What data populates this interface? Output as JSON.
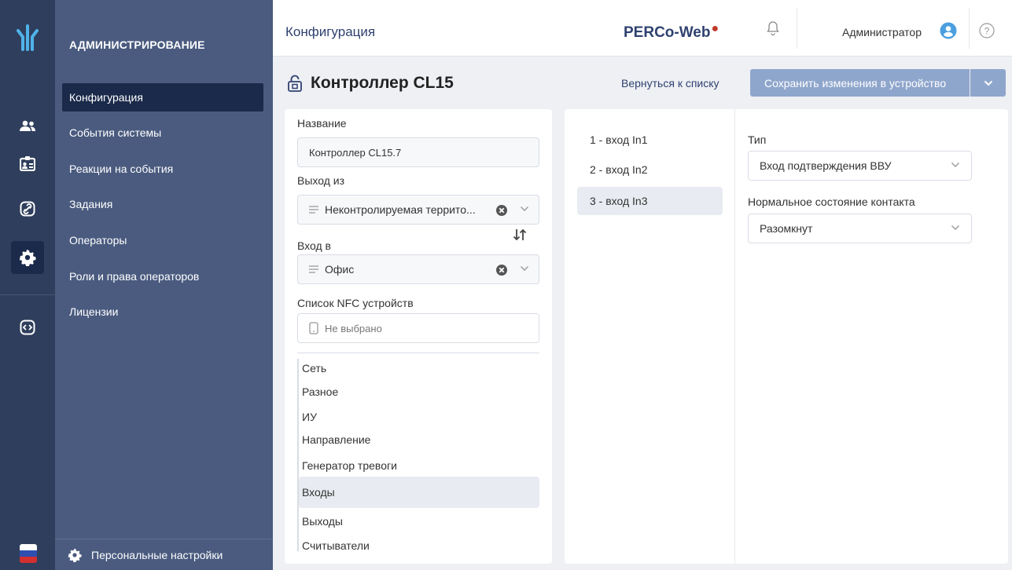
{
  "colors": {
    "rail": "#2f3e5c",
    "nav": "#4a5b7f",
    "nav_active": "#1b2a4a",
    "brand": "#2f4170",
    "save_button": "#8fa6cc",
    "selection": "#e8ebf1"
  },
  "rail": {
    "icons": [
      "logo-icon",
      "people-icon",
      "badge-icon",
      "link-icon",
      "gear-icon",
      "code-icon",
      "flag-icon"
    ]
  },
  "nav": {
    "section_title": "АДМИНИСТРИРОВАНИЕ",
    "items": [
      {
        "label": "Конфигурация",
        "active": true
      },
      {
        "label": "События системы"
      },
      {
        "label": "Реакции на события"
      },
      {
        "label": "Задания"
      },
      {
        "label": "Операторы"
      },
      {
        "label": "Роли и права операторов"
      },
      {
        "label": "Лицензии"
      }
    ],
    "personal_settings": "Персональные настройки"
  },
  "header": {
    "breadcrumb": "Конфигурация",
    "brand": "PERCo-Web",
    "user": "Администратор"
  },
  "page": {
    "title": "Контроллер CL15",
    "back_link": "Вернуться к списку",
    "save_button": "Сохранить изменения в устройство"
  },
  "form": {
    "name_label": "Название",
    "name_value": "Контроллер CL15.7",
    "exit_label": "Выход из",
    "exit_value": "Неконтролируемая террито...",
    "entry_label": "Вход в",
    "entry_value": "Офис",
    "nfc_label": "Список NFC устройств",
    "nfc_placeholder": "Не выбрано"
  },
  "sections": [
    "Сеть",
    "Разное",
    "ИУ",
    "Направление",
    "Генератор тревоги",
    "Входы",
    "Выходы",
    "Считыватели"
  ],
  "active_section": "Входы",
  "inputs": [
    "1 - вход In1",
    "2 - вход In2",
    "3 - вход In3"
  ],
  "active_input": "3 - вход In3",
  "input_settings": {
    "type_label": "Тип",
    "type_value": "Вход подтверждения ВВУ",
    "contact_label": "Нормальное состояние контакта",
    "contact_value": "Разомкнут"
  }
}
